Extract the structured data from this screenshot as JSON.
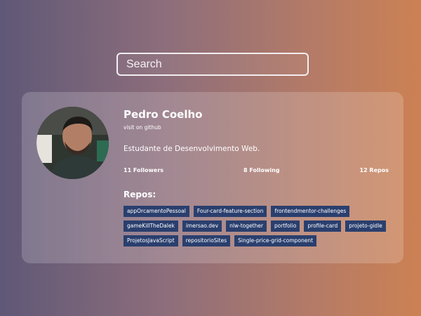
{
  "search": {
    "placeholder": "Search"
  },
  "profile": {
    "name": "Pedro Coelho",
    "link_label": "visit on github",
    "bio": "Estudante de Desenvolvimento Web.",
    "followers": "11 Followers",
    "following": "8 Following",
    "repos_count": "12 Repos"
  },
  "repos": {
    "title": "Repos:",
    "items": [
      "appOrcamentoPessoal",
      "Four-card-feature-section",
      "frontendmentor-challenges",
      "gameKillTheDalek",
      "imersao.dev",
      "nlw-together",
      "portfolio",
      "profile-card",
      "projeto-gidle",
      "ProjetosJavaScript",
      "repositorioSites",
      "Single-price-grid-component"
    ]
  },
  "colors": {
    "repo_tag_bg": "#2a3f6e",
    "gradient_left": "#5f5877",
    "gradient_right": "#cc8153"
  }
}
